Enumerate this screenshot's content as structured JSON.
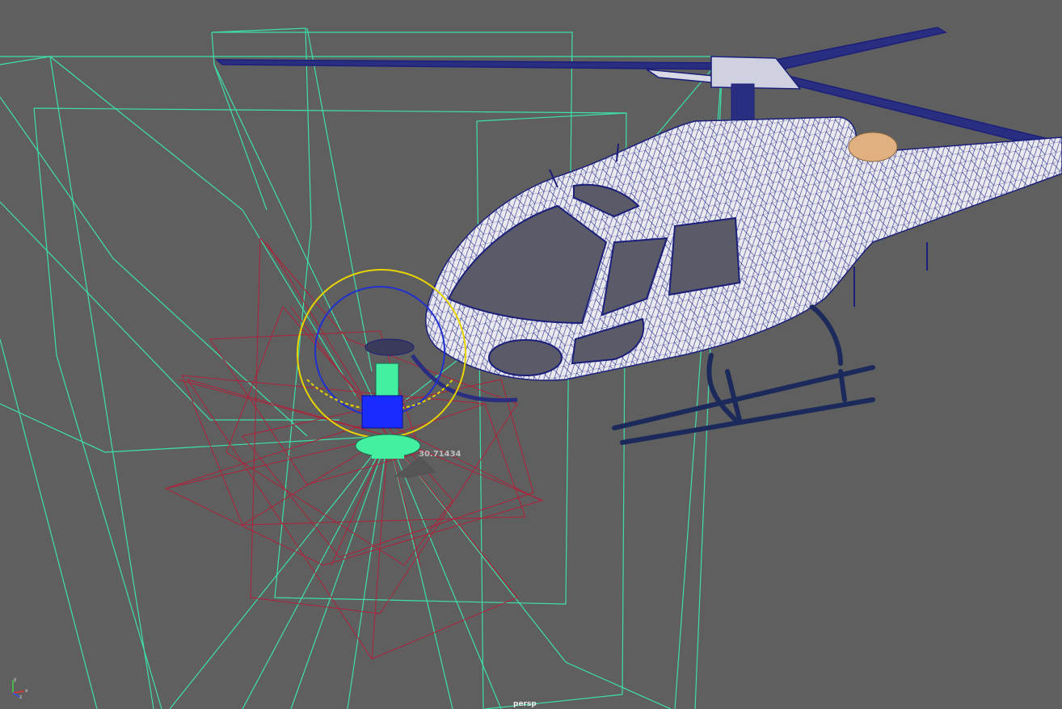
{
  "viewport": {
    "camera_label": "persp",
    "measure_value": "30.71434",
    "axis_labels": {
      "x": "x",
      "y": "y",
      "z": "z"
    }
  },
  "colors": {
    "background": "#5f5f5f",
    "camera_frustum": "#3ee0a8",
    "light_lines": "#b0213a",
    "mesh_wire": "#1b1f7a",
    "mesh_fill": "#e9e9ee",
    "manipulator_yellow": "#e8d400",
    "manipulator_blue": "#2030d0",
    "rig_green": "#43f0a0",
    "rig_blue": "#1a2bff"
  },
  "objects": [
    "camera-frustums",
    "light-rig",
    "helicopter-mesh",
    "rotate-manipulator",
    "camera-rig-model"
  ]
}
